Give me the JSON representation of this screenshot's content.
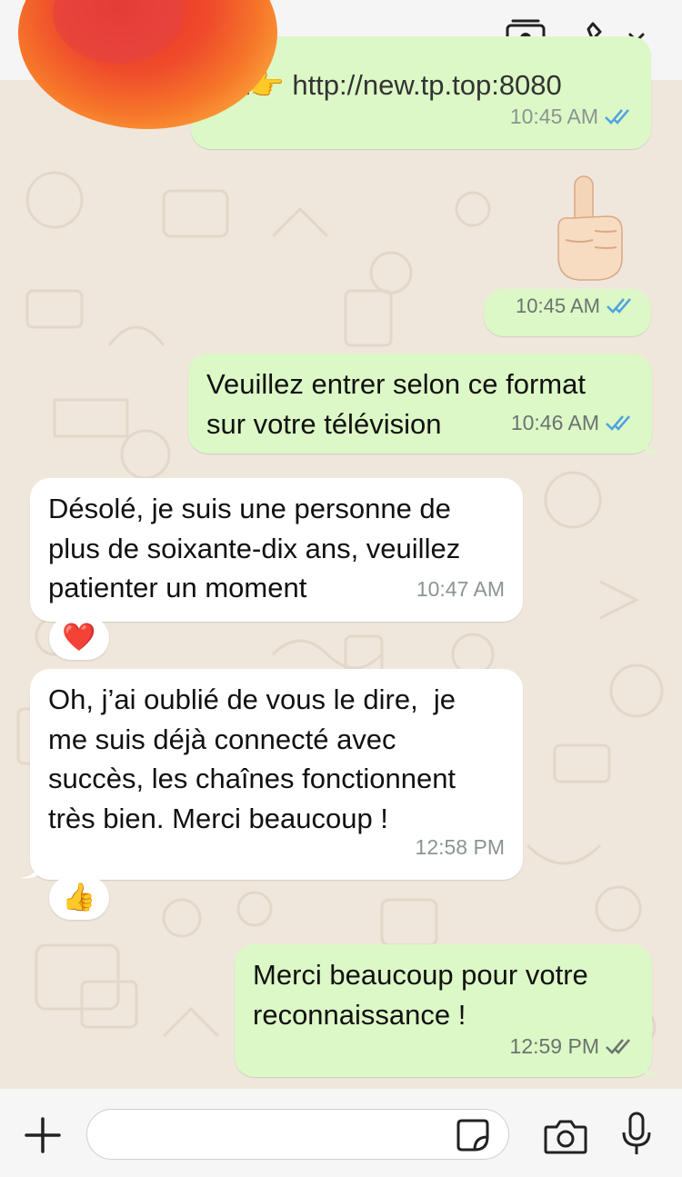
{
  "header": {
    "back_icon": "chevron-left-icon",
    "avatar_icon": "flame-avatar",
    "contact_icon": "contact-card-icon",
    "call_icon": "phone-icon",
    "call_menu_icon": "chevron-down-icon"
  },
  "messages": [
    {
      "direction": "out",
      "text": "st👉 http://new.tp.top:8080",
      "time": "10:45 AM",
      "status": "read"
    },
    {
      "direction": "out",
      "emoji": "☝🏻",
      "time": "10:45 AM",
      "status": "read"
    },
    {
      "direction": "out",
      "text": "Veuillez entrer selon ce format\nsur votre télévision",
      "time": "10:46 AM",
      "status": "read"
    },
    {
      "direction": "in",
      "text": "Désolé, je suis une personne de\nplus de soixante-dix ans, veuillez\npatienter un moment",
      "time": "10:47 AM",
      "reaction": "❤️"
    },
    {
      "direction": "in",
      "text": "Oh, j’ai oublié de vous le dire,  je\nme suis déjà connecté avec\nsuccès, les chaînes fonctionnent\ntrès bien. Merci beaucoup !",
      "time": "12:58 PM",
      "reaction": "👍"
    },
    {
      "direction": "out",
      "text": "Merci beaucoup pour votre\nreconnaissance !",
      "time": "12:59 PM",
      "status": "delivered"
    }
  ],
  "composer": {
    "placeholder": "",
    "plus_icon": "plus-icon",
    "sticker_icon": "sticker-icon",
    "camera_icon": "camera-icon",
    "mic_icon": "microphone-icon"
  },
  "colors": {
    "outgoing_bubble": "#dcf8c6",
    "incoming_bubble": "#ffffff",
    "read_ticks": "#4fa3e0",
    "delivered_ticks": "#8b9492",
    "wallpaper": "#efe7dc"
  }
}
